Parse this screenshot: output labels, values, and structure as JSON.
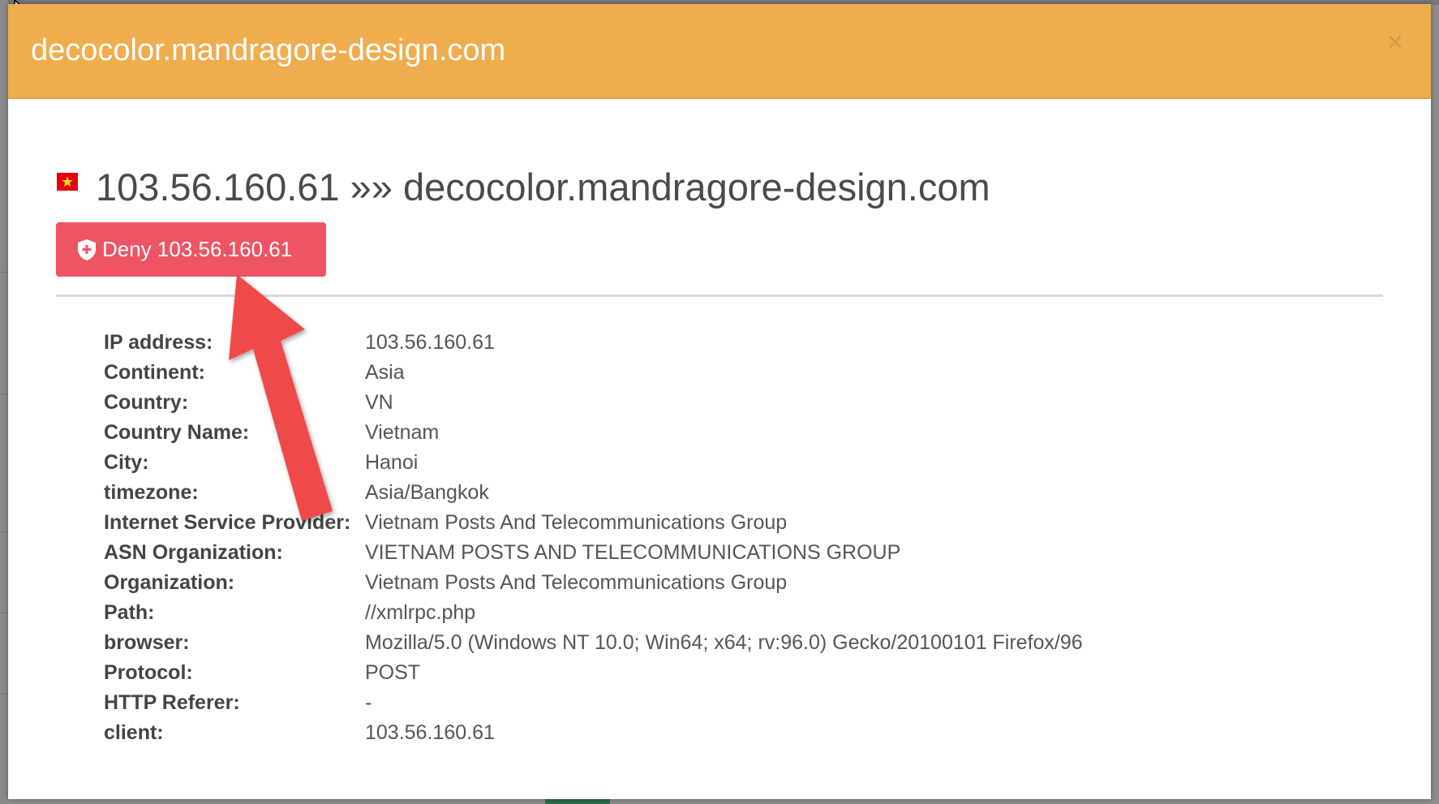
{
  "modal": {
    "title": "decocolor.mandragore-design.com",
    "close_symbol": "×",
    "heading": "103.56.160.61 »» decocolor.mandragore-design.com",
    "flag_icon": "vietnam-flag-icon",
    "deny_button": {
      "label": "Deny 103.56.160.61",
      "icon": "shield-plus-icon",
      "color": "#ed5565"
    },
    "header_color": "#f0ad4e",
    "details": [
      {
        "label": "IP address:",
        "value": "103.56.160.61"
      },
      {
        "label": "Continent:",
        "value": "Asia"
      },
      {
        "label": "Country:",
        "value": "VN"
      },
      {
        "label": "Country Name:",
        "value": "Vietnam"
      },
      {
        "label": "City:",
        "value": "Hanoi"
      },
      {
        "label": "timezone:",
        "value": "Asia/Bangkok"
      },
      {
        "label": "Internet Service Provider:",
        "value": "Vietnam Posts And Telecommunications Group"
      },
      {
        "label": "ASN Organization:",
        "value": "VIETNAM POSTS AND TELECOMMUNICATIONS GROUP"
      },
      {
        "label": "Organization:",
        "value": "Vietnam Posts And Telecommunications Group"
      },
      {
        "label": "Path:",
        "value": "//xmlrpc.php"
      },
      {
        "label": "browser:",
        "value": "Mozilla/5.0 (Windows NT 10.0; Win64; x64; rv:96.0) Gecko/20100101 Firefox/96"
      },
      {
        "label": "Protocol:",
        "value": "POST"
      },
      {
        "label": "HTTP Referer:",
        "value": "-"
      },
      {
        "label": "client:",
        "value": "103.56.160.61"
      }
    ]
  },
  "annotation": {
    "arrow_color": "#f04a4a"
  }
}
